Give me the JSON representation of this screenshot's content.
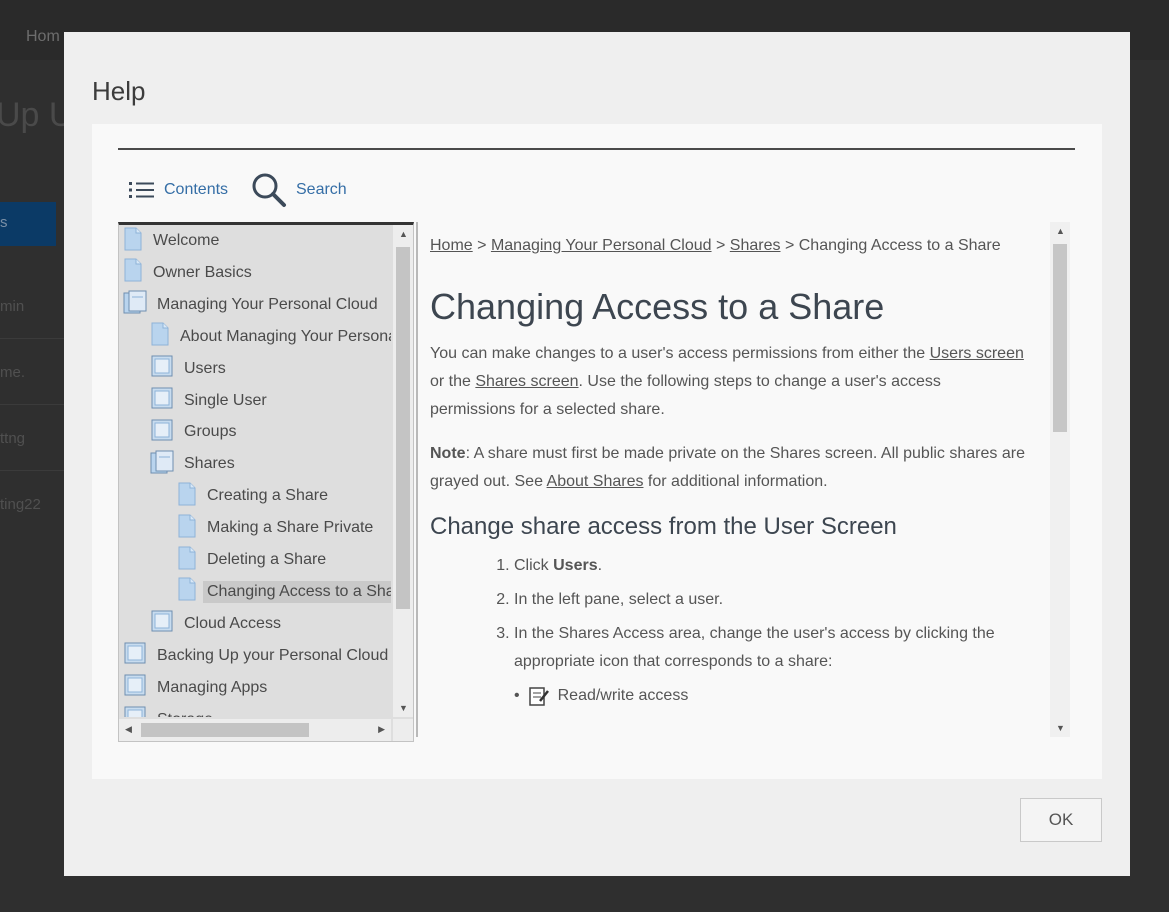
{
  "background": {
    "home_label": "Hom",
    "page_title_fragment": "Up U",
    "active_item": "s",
    "items": [
      "min",
      "me.",
      "ttng",
      "ting22"
    ]
  },
  "dialog": {
    "title": "Help",
    "ok_label": "OK"
  },
  "toolbar": {
    "contents_label": "Contents",
    "search_label": "Search"
  },
  "tree": {
    "items": [
      {
        "label": "Welcome",
        "icon": "page-icon"
      },
      {
        "label": "Owner Basics",
        "icon": "page-icon"
      },
      {
        "label": "Managing Your Personal Cloud",
        "icon": "book-open-icon"
      },
      {
        "label": "About Managing Your Personal Cloud",
        "icon": "page-icon"
      },
      {
        "label": "Users",
        "icon": "book-icon"
      },
      {
        "label": "Single User",
        "icon": "book-icon"
      },
      {
        "label": "Groups",
        "icon": "book-icon"
      },
      {
        "label": "Shares",
        "icon": "book-open-icon"
      },
      {
        "label": "Creating a Share",
        "icon": "page-icon"
      },
      {
        "label": "Making a Share Private",
        "icon": "page-icon"
      },
      {
        "label": "Deleting a Share",
        "icon": "page-icon"
      },
      {
        "label": "Changing Access to a Share",
        "icon": "page-icon",
        "selected": true
      },
      {
        "label": "Cloud Access",
        "icon": "book-icon"
      },
      {
        "label": "Backing Up your Personal Cloud",
        "icon": "book-icon"
      },
      {
        "label": "Managing Apps",
        "icon": "book-icon"
      },
      {
        "label": "Storage",
        "icon": "book-icon"
      }
    ]
  },
  "article": {
    "breadcrumb": {
      "home": "Home",
      "sep": ">",
      "section": "Managing Your Personal Cloud",
      "subsection": "Shares",
      "current": "Changing Access to a Share"
    },
    "title": "Changing Access to a Share",
    "intro": {
      "before": "You can make changes to a user's access permissions from either the ",
      "link1": "Users screen",
      "mid": " or the ",
      "link2": "Shares screen",
      "after": ". Use the following steps to change a user's access permissions for a selected share."
    },
    "note": {
      "label": "Note",
      "text": ": A share must first be made private on the Shares screen. All public shares are grayed out. See ",
      "link": "About Shares",
      "after": " for additional information."
    },
    "subheading": "Change share access from the User Screen",
    "steps": {
      "s1_before": "Click ",
      "s1_bold": "Users",
      "s1_after": ".",
      "s2": "In the left pane, select a user.",
      "s3": "In the Shares Access area, change the user's access by clicking the appropriate icon that corresponds to a share:"
    },
    "bullet1": "Read/write access"
  }
}
